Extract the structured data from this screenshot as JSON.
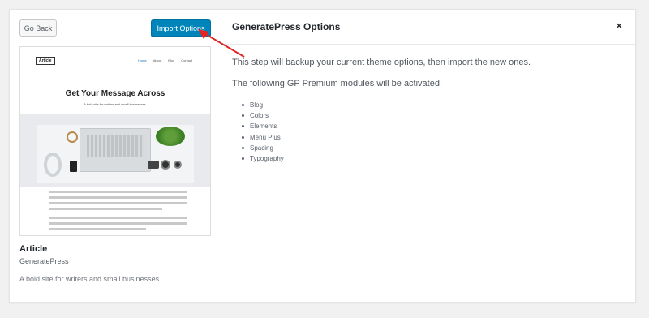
{
  "left": {
    "go_back_label": "Go Back",
    "import_label": "Import Options",
    "site_name": "Article",
    "site_author": "GeneratePress",
    "site_description": "A bold site for writers and small businesses."
  },
  "preview": {
    "logo": "Article",
    "nav": [
      "Home",
      "About",
      "Blog",
      "Contact"
    ],
    "title": "Get Your Message Across",
    "subtitle": "A bold site for writers and small businesses."
  },
  "right": {
    "title": "GeneratePress Options",
    "close_symbol": "×",
    "step_text": "This step will backup your current theme options, then import the new ones.",
    "modules_intro": "The following GP Premium modules will be activated:",
    "modules": [
      "Blog",
      "Colors",
      "Elements",
      "Menu Plus",
      "Spacing",
      "Typography"
    ]
  },
  "colors": {
    "primary_button": "#0085ba",
    "annotation_arrow": "#e02424",
    "page_background": "#f1f1f1"
  },
  "icons": {
    "close": "close-icon",
    "annotation": "arrow-annotation-icon"
  }
}
